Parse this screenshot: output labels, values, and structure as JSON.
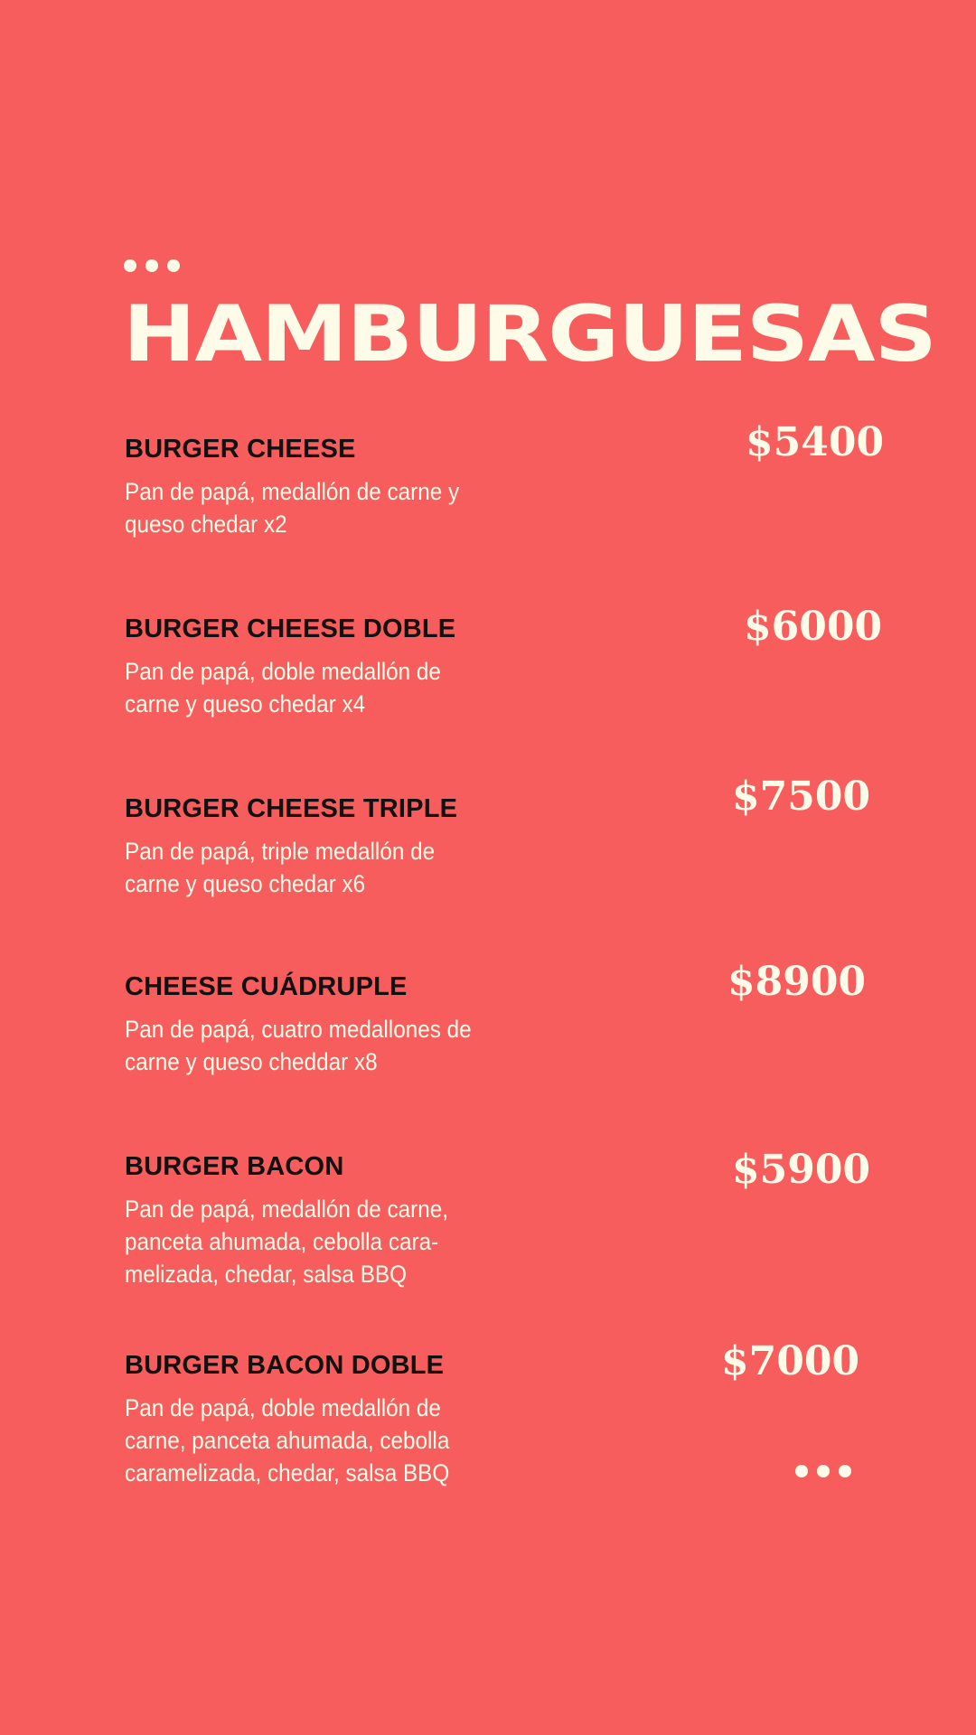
{
  "menu": {
    "title": "HAMBURGUESAS",
    "items": [
      {
        "name": "BURGER CHEESE",
        "description": "Pan de papá, medallón de carne y queso chedar x2",
        "price": "$5400"
      },
      {
        "name": "BURGER CHEESE DOBLE",
        "description": "Pan de papá, doble medallón de carne y queso chedar x4",
        "price": "$6000"
      },
      {
        "name": "BURGER CHEESE TRIPLE",
        "description": "Pan de papá, triple medallón de carne y queso chedar x6",
        "price": "$7500"
      },
      {
        "name": "CHEESE CUÁDRUPLE",
        "description": "Pan de papá, cuatro medallones de carne y queso cheddar x8",
        "price": "$8900"
      },
      {
        "name": "BURGER BACON",
        "description": "Pan de papá, medallón de carne, panceta ahumada, cebolla cara-melizada, chedar, salsa BBQ",
        "price": "$5900"
      },
      {
        "name": "BURGER BACON DOBLE",
        "description": "Pan de papá, doble medallón de carne, panceta ahumada, cebolla caramelizada, chedar, salsa BBQ",
        "price": "$7000"
      }
    ]
  },
  "colors": {
    "background": "#f75d5d",
    "cream": "#fffbe9",
    "dark": "#111111"
  }
}
